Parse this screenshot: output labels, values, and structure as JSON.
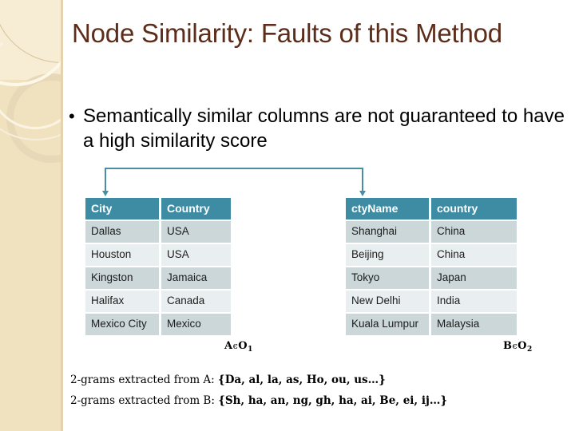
{
  "slide": {
    "title": "Node Similarity: Faults of this Method",
    "bullets": [
      {
        "marker": "•",
        "text": "Semantically similar columns are not guaranteed to have a high similarity score"
      }
    ]
  },
  "connector": {
    "name": "double-headed-bracket",
    "from": "City",
    "to": "ctyName",
    "color": "#4a8ea3"
  },
  "colors": {
    "title": "#5c2d1b",
    "table_header_bg": "#3e8ca4",
    "table_header_fg": "#ffffff",
    "row_odd_bg": "#ccd7da",
    "row_even_bg": "#e9eff1",
    "band_base": "#f1e2bf",
    "band_top": "#f7ecd4",
    "accent": "#4a8ea3"
  },
  "table_a": {
    "id": "A",
    "set_label": {
      "name": "A",
      "relation": "ϵ",
      "set": "O",
      "subscript": "1"
    },
    "headers": [
      "City",
      "Country"
    ],
    "rows": [
      [
        "Dallas",
        "USA"
      ],
      [
        "Houston",
        "USA"
      ],
      [
        "Kingston",
        "Jamaica"
      ],
      [
        "Halifax",
        "Canada"
      ],
      [
        "Mexico City",
        "Mexico"
      ]
    ]
  },
  "table_b": {
    "id": "B",
    "set_label": {
      "name": "B",
      "relation": "ϵ",
      "set": "O",
      "subscript": "2"
    },
    "headers": [
      "ctyName",
      "country"
    ],
    "rows": [
      [
        "Shanghai",
        "China"
      ],
      [
        "Beijing",
        "China"
      ],
      [
        "Tokyo",
        "Japan"
      ],
      [
        "New Delhi",
        "India"
      ],
      [
        "Kuala Lumpur",
        "Malaysia"
      ]
    ]
  },
  "footnotes": [
    {
      "prefix": "2-grams extracted from A: ",
      "set": "{Da, al, la, as, Ho, ou, us…}"
    },
    {
      "prefix": "2-grams extracted from B: ",
      "set": "{Sh, ha, an, ng, gh, ha, ai, Be, ei, ij…}"
    }
  ]
}
